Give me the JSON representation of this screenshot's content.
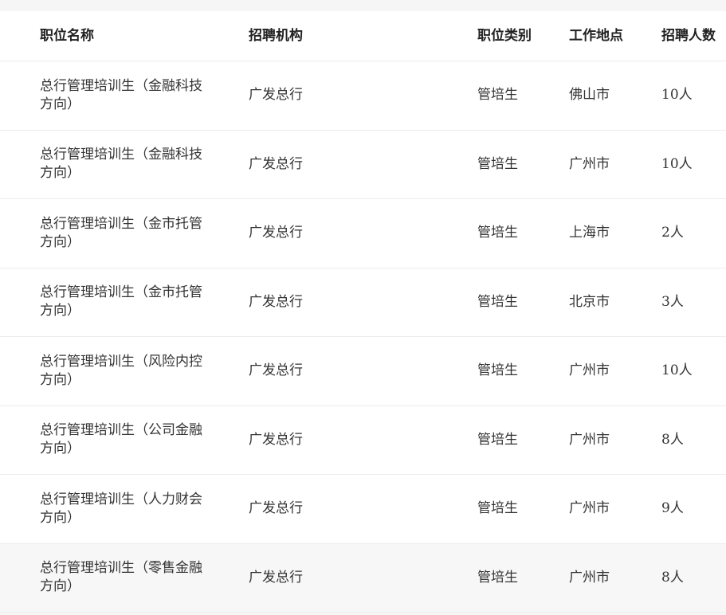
{
  "table": {
    "headers": {
      "name": "职位名称",
      "org": "招聘机构",
      "type": "职位类别",
      "location": "工作地点",
      "count": "招聘人数"
    },
    "rows": [
      {
        "name": "总行管理培训生（金融科技方向）",
        "org": "广发总行",
        "type": "管培生",
        "location": "佛山市",
        "count": "10人"
      },
      {
        "name": "总行管理培训生（金融科技方向）",
        "org": "广发总行",
        "type": "管培生",
        "location": "广州市",
        "count": "10人"
      },
      {
        "name": "总行管理培训生（金市托管方向）",
        "org": "广发总行",
        "type": "管培生",
        "location": "上海市",
        "count": "2人"
      },
      {
        "name": "总行管理培训生（金市托管方向）",
        "org": "广发总行",
        "type": "管培生",
        "location": "北京市",
        "count": "3人"
      },
      {
        "name": "总行管理培训生（风险内控方向）",
        "org": "广发总行",
        "type": "管培生",
        "location": "广州市",
        "count": "10人"
      },
      {
        "name": "总行管理培训生（公司金融方向）",
        "org": "广发总行",
        "type": "管培生",
        "location": "广州市",
        "count": "8人"
      },
      {
        "name": "总行管理培训生（人力财会方向）",
        "org": "广发总行",
        "type": "管培生",
        "location": "广州市",
        "count": "9人"
      },
      {
        "name": "总行管理培训生（零售金融方向）",
        "org": "广发总行",
        "type": "管培生",
        "location": "广州市",
        "count": "8人"
      }
    ]
  }
}
